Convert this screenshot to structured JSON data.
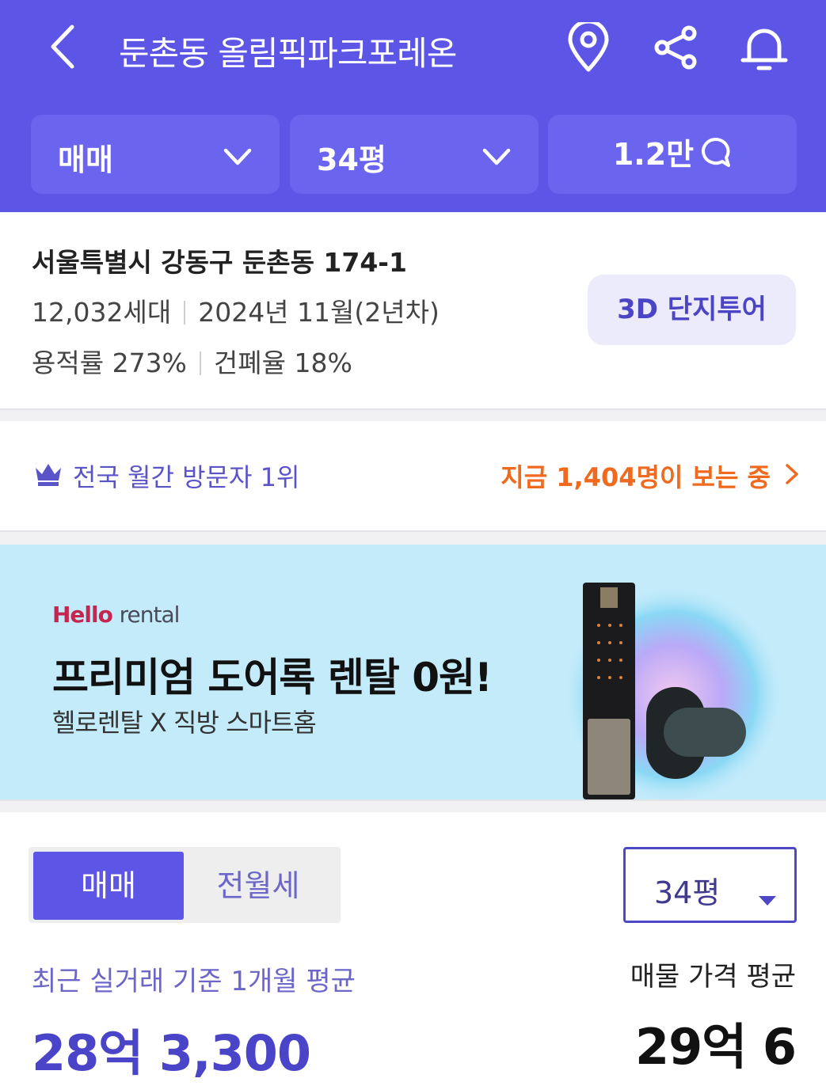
{
  "header": {
    "title": "둔촌동 올림픽파크포레온",
    "icons": [
      "back-icon",
      "location-pin-icon",
      "share-icon",
      "bell-icon"
    ],
    "filters": {
      "deal_type": "매매",
      "size": "34평",
      "comments": "1.2만"
    }
  },
  "complex": {
    "address": "서울특별시 강동구 둔촌동 174-1",
    "households": "12,032세대",
    "completion": "2024년 11월(2년차)",
    "floor_area_ratio": "용적률 273%",
    "building_coverage": "건폐율 18%",
    "tour_button": "3D 단지투어"
  },
  "rank": {
    "label": "전국 월간 방문자 1위",
    "live_viewers": "지금 1,404명이 보는 중"
  },
  "banner": {
    "brand_hello": "Hello",
    "brand_rental": "rental",
    "headline": "프리미엄 도어록 렌탈 0원!",
    "subline": "헬로렌탈 X 직방 스마트홈"
  },
  "price": {
    "tabs": [
      "매매",
      "전월세"
    ],
    "size_select": "34평",
    "recent_caption": "최근 실거래 기준 1개월 평균",
    "recent_price": "28억 3,300",
    "listing_caption": "매물 가격 평균",
    "listing_price": "29억 6"
  },
  "colors": {
    "brand": "#5c55e6",
    "accent_orange": "#ef6a1f",
    "banner_bg": "#c4ebfa"
  }
}
